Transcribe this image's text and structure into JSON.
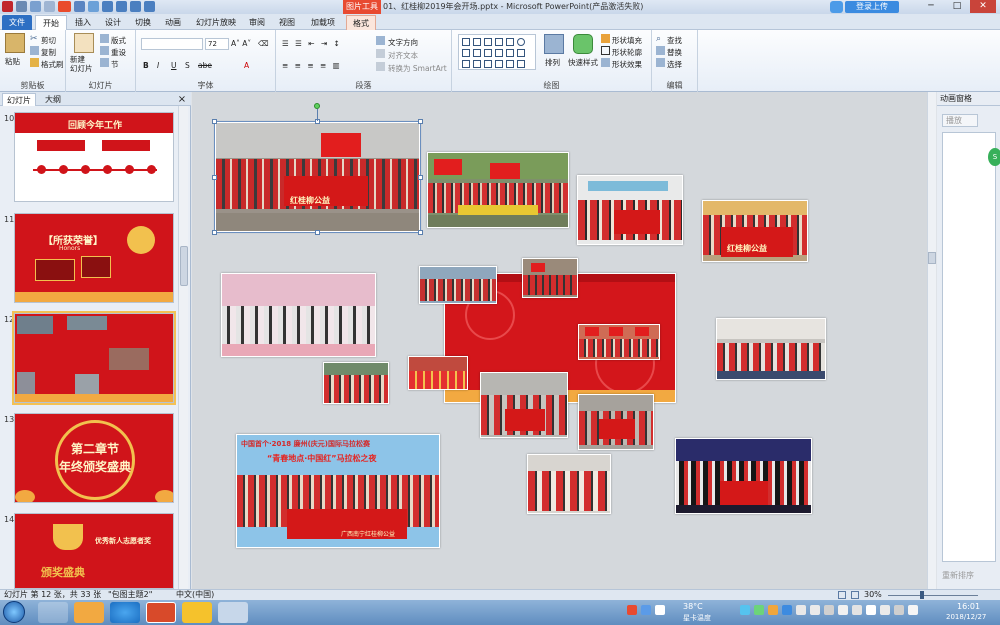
{
  "window": {
    "title": "01、红桂柳2019年会开场.pptx - Microsoft PowerPoint(产品激活失败)",
    "picture_tools_label": "图片工具",
    "login_label": "登录上传",
    "controls": [
      "─",
      "□",
      "✕"
    ]
  },
  "tabs": [
    "文件",
    "开始",
    "插入",
    "设计",
    "切换",
    "动画",
    "幻灯片放映",
    "审阅",
    "视图",
    "加载项",
    "格式"
  ],
  "ribbon": {
    "clipboard": {
      "label": "剪贴板",
      "paste": "粘贴",
      "cut": "剪切",
      "copy": "复制",
      "format_painter": "格式刷"
    },
    "slides": {
      "label": "幻灯片",
      "new_slide": "新建\n幻灯片",
      "layout": "版式",
      "reset": "重设",
      "section": "节"
    },
    "font": {
      "label": "字体",
      "size": "72",
      "buttons": [
        "B",
        "I",
        "U",
        "S",
        "abe",
        "A"
      ]
    },
    "paragraph": {
      "label": "段落",
      "text_direction": "文字方向",
      "align_text": "对齐文本",
      "smartart": "转换为 SmartArt"
    },
    "drawing": {
      "label": "绘图",
      "arrange": "排列",
      "quick_styles": "快速样式",
      "shape_fill": "形状填充",
      "shape_outline": "形状轮廓",
      "shape_effects": "形状效果"
    },
    "editing": {
      "label": "编辑",
      "find": "查找",
      "replace": "替换",
      "select": "选择"
    }
  },
  "left_panel": {
    "tabs": [
      "幻灯片",
      "大纲"
    ],
    "close": "×",
    "slides": [
      {
        "num": "10",
        "title": "回顾今年工作"
      },
      {
        "num": "11",
        "title": "【所获荣誉】",
        "subtitle": "Honors"
      },
      {
        "num": "12",
        "title": ""
      },
      {
        "num": "13",
        "title": "第二章节",
        "subtitle": "年终颁奖盛典"
      },
      {
        "num": "14",
        "title": "优秀新人志愿者奖",
        "subtitle": "颁奖盛典"
      }
    ]
  },
  "canvas_photos": {
    "banner_text": "红桂柳公益",
    "poster_title": "中国首个·2018 廉州(庆元)国际马拉松赛",
    "poster_sub": "“青春地点·中国红”马拉松之夜",
    "poster_banner": "广西南宁红桂柳公益"
  },
  "right_panel": {
    "title": "动画窗格",
    "add_animation": "播放",
    "reorder": "重新排序"
  },
  "statusbar": {
    "slide_info": "幻灯片 第 12 张，共 33 张",
    "theme": "\"包图主题2\"",
    "language": "中文(中国)",
    "zoom": "30%"
  },
  "taskbar": {
    "temperature": "38°C",
    "weather": "星卡温度",
    "time": "16:01",
    "date": "2018/12/27"
  },
  "colors": {
    "accent": "#2d6fc3",
    "slide_red": "#d0141a",
    "picture_tools": "#e84a31"
  }
}
